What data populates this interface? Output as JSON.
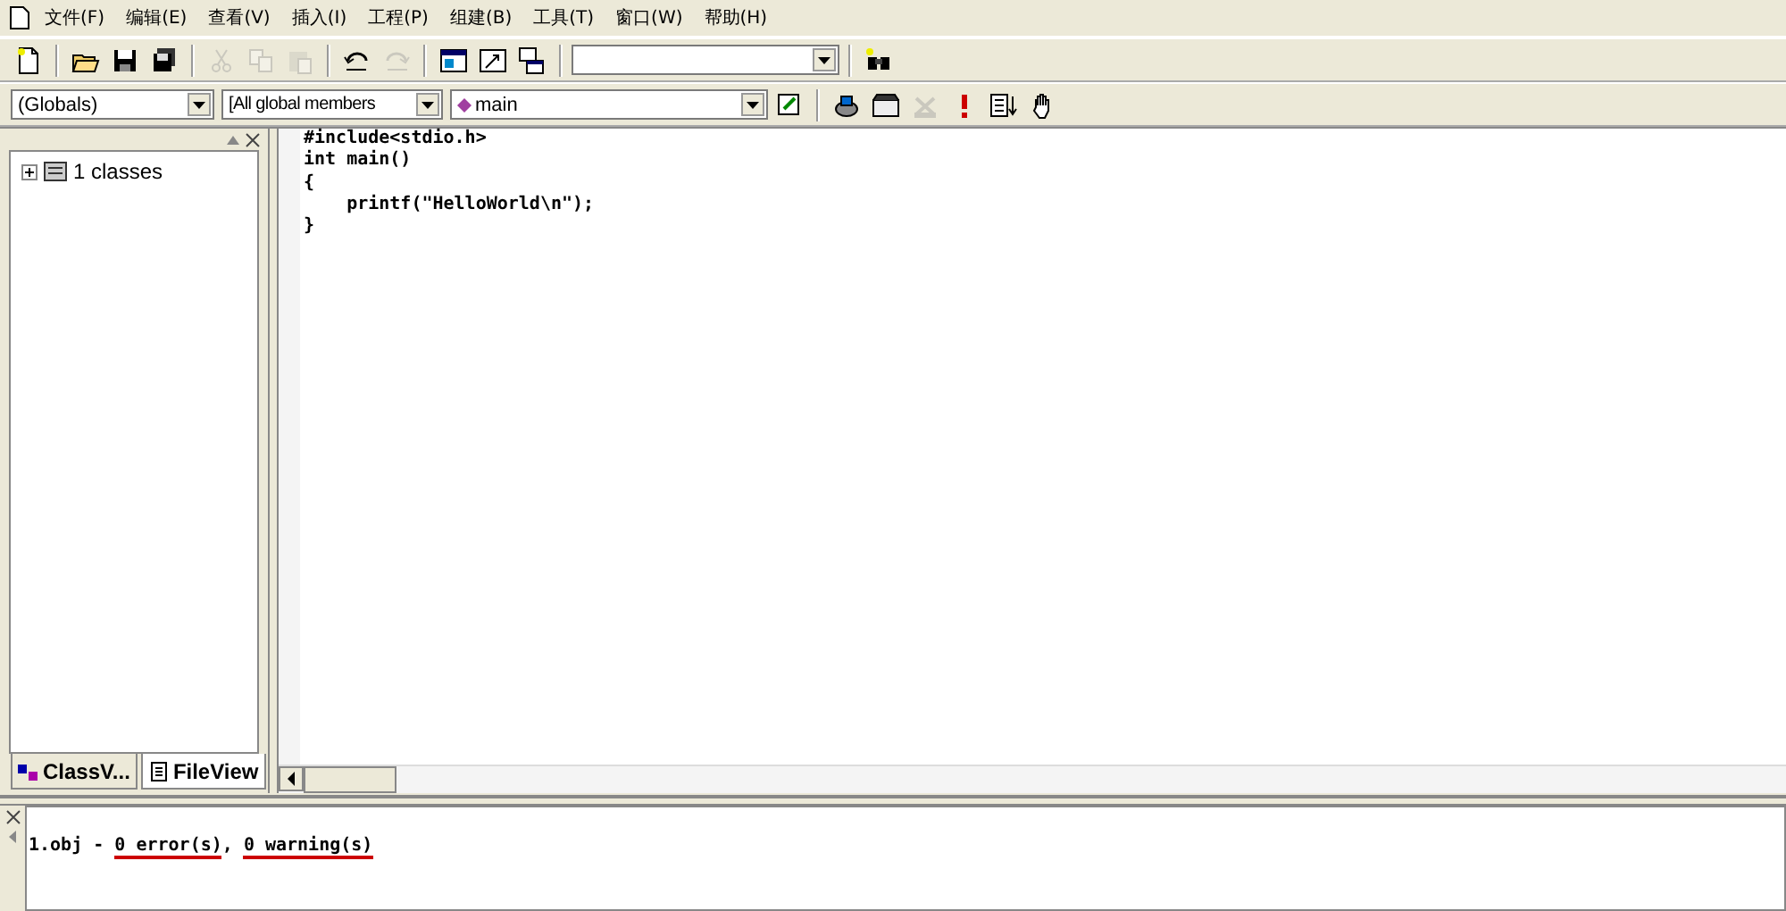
{
  "menu_bar": [
    {
      "label": "文件(F)"
    },
    {
      "label": "编辑(E)"
    },
    {
      "label": "查看(V)"
    },
    {
      "label": "插入(I)"
    },
    {
      "label": "工程(P)"
    },
    {
      "label": "组建(B)"
    },
    {
      "label": "工具(T)"
    },
    {
      "label": "窗口(W)"
    },
    {
      "label": "帮助(H)"
    }
  ],
  "standard_toolbar": {
    "buttons": [
      {
        "disabled": false
      },
      {
        "disabled": false
      },
      {
        "disabled": false
      },
      {
        "disabled": false
      },
      {
        "disabled": true
      },
      {
        "disabled": true
      },
      {
        "disabled": true
      },
      {
        "disabled": false
      },
      {
        "disabled": true
      },
      {
        "disabled": false
      },
      {
        "disabled": false
      },
      {
        "disabled": false
      },
      {
        "disabled": false
      }
    ]
  },
  "wizard_bar": {
    "scope": "(Globals)",
    "filter": "[All global members",
    "member": "main"
  },
  "build_toolbar": {
    "buttons": [
      {
        "disabled": false
      },
      {
        "disabled": false
      },
      {
        "disabled": true
      },
      {
        "disabled": false
      },
      {
        "disabled": false
      },
      {
        "disabled": false
      }
    ]
  },
  "class_view": {
    "tree": [
      {
        "label": "1 classes",
        "expanded": false
      }
    ],
    "tabs": [
      {
        "label": "ClassV...",
        "selected": false
      },
      {
        "label": "FileView",
        "selected": true
      }
    ]
  },
  "editor": {
    "lines": [
      "#include<stdio.h>",
      "int main()",
      "{",
      "    printf(\"HelloWorld\\n\");",
      "}"
    ]
  },
  "output": {
    "segments": [
      {
        "text": "1.obj - ",
        "underlined": false
      },
      {
        "text": "0 error(s)",
        "underlined": true
      },
      {
        "text": ", ",
        "underlined": false
      },
      {
        "text": "0 warning(s)",
        "underlined": true
      }
    ]
  }
}
